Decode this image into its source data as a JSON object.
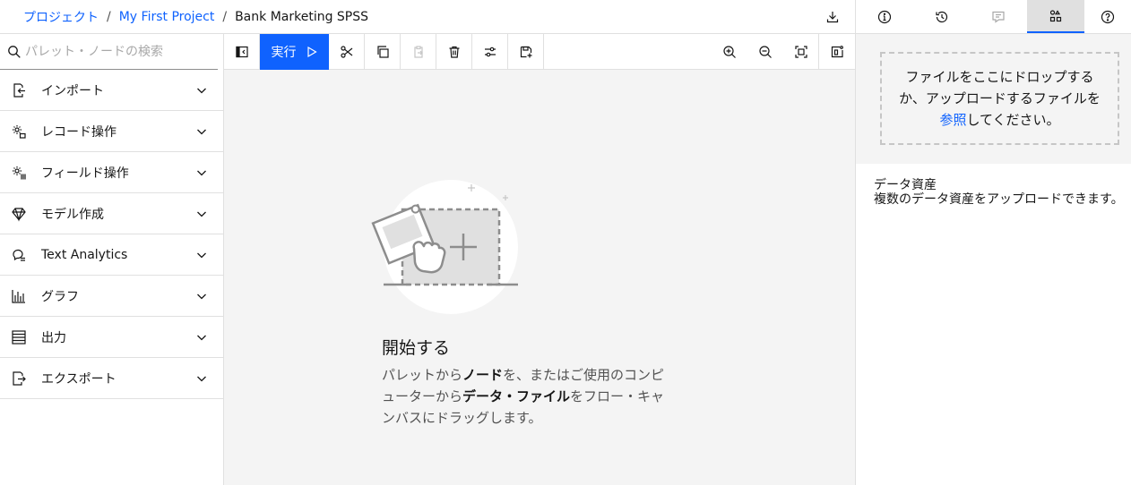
{
  "header": {
    "breadcrumbs": [
      "プロジェクト",
      "My First Project"
    ],
    "separator": "/",
    "current": "Bank Marketing SPSS",
    "download_icon": "download-icon"
  },
  "right_tabs": [
    {
      "name": "info",
      "icon": "info-icon"
    },
    {
      "name": "history",
      "icon": "history-icon"
    },
    {
      "name": "comments",
      "icon": "chat-icon"
    },
    {
      "name": "assets",
      "icon": "data-assets-icon",
      "active": true
    },
    {
      "name": "help",
      "icon": "help-icon"
    }
  ],
  "palette": {
    "search_placeholder": "パレット・ノードの検索",
    "categories": [
      {
        "label": "インポート",
        "icon": "import-icon"
      },
      {
        "label": "レコード操作",
        "icon": "record-ops-icon"
      },
      {
        "label": "フィールド操作",
        "icon": "field-ops-icon"
      },
      {
        "label": "モデル作成",
        "icon": "diamond-icon"
      },
      {
        "label": "Text Analytics",
        "icon": "text-analytics-icon"
      },
      {
        "label": "グラフ",
        "icon": "bar-chart-icon"
      },
      {
        "label": "出力",
        "icon": "output-icon"
      },
      {
        "label": "エクスポート",
        "icon": "export-icon"
      }
    ]
  },
  "toolbar": {
    "run_label": "実行"
  },
  "canvas": {
    "empty_title": "開始する",
    "desc_1": "パレットから",
    "desc_bold_1": "ノード",
    "desc_2": "を、またはご使用のコンピューターから",
    "desc_bold_2": "データ・ファイル",
    "desc_3": "をフロー・キャンバスにドラッグします。"
  },
  "assets_panel": {
    "drop_text_1": "ファイルをここにドロップするか、アップロードするファイルを",
    "drop_link": "参照",
    "drop_text_2": "してください。",
    "title": "データ資産",
    "description": "複数のデータ資産をアップロードできます。"
  },
  "colors": {
    "accent": "#0f62fe",
    "canvas_bg": "#f4f4f4",
    "border": "#e0e0e0"
  }
}
